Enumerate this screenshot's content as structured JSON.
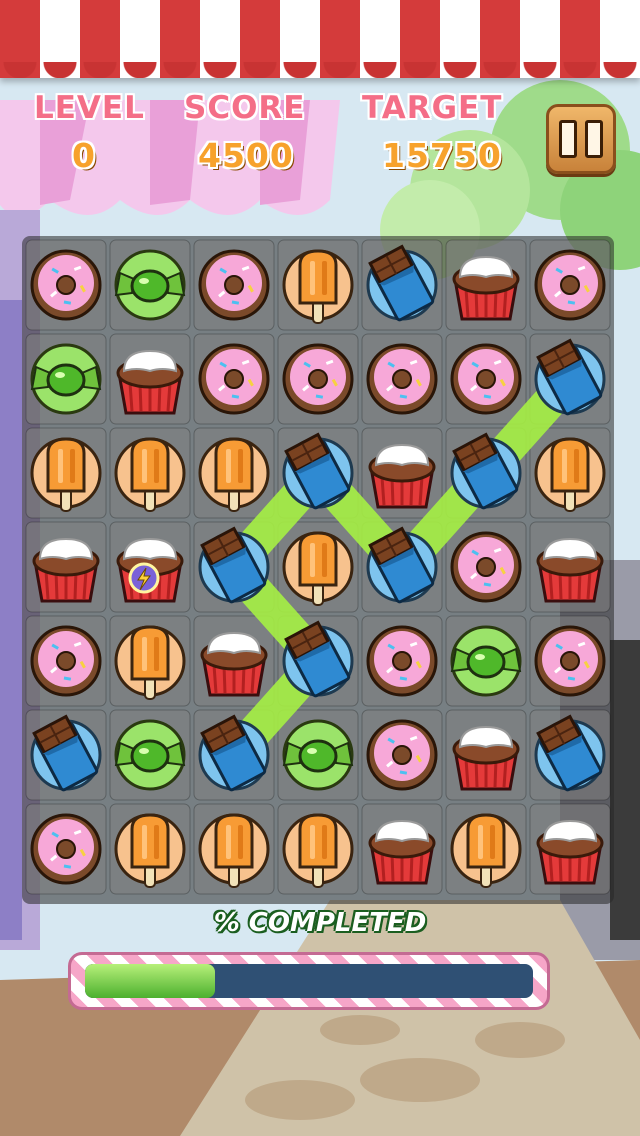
{
  "hud": {
    "level_label": "LEVEL",
    "level_value": "0",
    "score_label": "SCORE",
    "score_value": "4500",
    "target_label": "TARGET",
    "target_value": "15750",
    "pause_icon": "pause-icon"
  },
  "progress": {
    "label": "% COMPLETED",
    "fraction": 0.29
  },
  "colors": {
    "label_pink": "#f46e87",
    "value_orange": "#f7a22c",
    "awning_red": "#d43b3b",
    "chain_green": "#a6f044",
    "progress_green": "#6ed23c",
    "progress_track": "#2f5074"
  },
  "board": {
    "rows": 7,
    "cols": 7,
    "grid": [
      [
        "donut",
        "candy",
        "donut",
        "popsicle",
        "chocolate",
        "cupcake",
        "donut"
      ],
      [
        "candy",
        "cupcake",
        "donut",
        "donut",
        "donut",
        "donut",
        "chocolate"
      ],
      [
        "popsicle",
        "popsicle",
        "popsicle",
        "chocolate",
        "cupcake",
        "chocolate",
        "popsicle"
      ],
      [
        "cupcake",
        "cupcake",
        "chocolate",
        "popsicle",
        "chocolate",
        "donut",
        "cupcake"
      ],
      [
        "donut",
        "popsicle",
        "cupcake",
        "chocolate",
        "donut",
        "candy",
        "donut"
      ],
      [
        "chocolate",
        "candy",
        "chocolate",
        "candy",
        "donut",
        "cupcake",
        "chocolate"
      ],
      [
        "donut",
        "popsicle",
        "popsicle",
        "popsicle",
        "cupcake",
        "popsicle",
        "cupcake"
      ]
    ],
    "selected_chain": [
      [
        5,
        2
      ],
      [
        4,
        3
      ],
      [
        3,
        2
      ],
      [
        2,
        3
      ],
      [
        3,
        4
      ],
      [
        2,
        5
      ],
      [
        1,
        6
      ]
    ],
    "powerup": {
      "row": 3,
      "col": 1,
      "icon": "lightning-icon"
    }
  }
}
